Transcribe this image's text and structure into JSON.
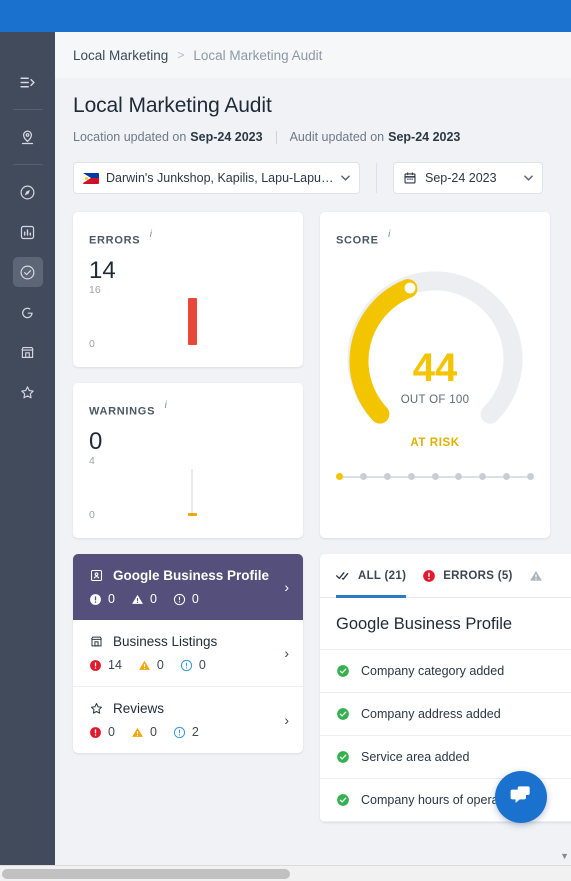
{
  "topbar": {
    "color": "#1b72ce"
  },
  "sidebar": {
    "toggle": {
      "icon": "collapse-menu-icon"
    },
    "items": [
      {
        "icon": "location-pin-icon",
        "name": "locations",
        "active": false
      },
      {
        "icon": "compass-icon",
        "name": "discovery",
        "active": false
      },
      {
        "icon": "bar-chart-icon",
        "name": "reports",
        "active": false
      },
      {
        "icon": "check-circle-icon",
        "name": "audit",
        "active": true
      },
      {
        "icon": "g-circle-icon",
        "name": "google",
        "active": false
      },
      {
        "icon": "store-icon",
        "name": "listings",
        "active": false
      },
      {
        "icon": "star-icon",
        "name": "reviews",
        "active": false
      }
    ]
  },
  "breadcrumb": {
    "parent": "Local Marketing",
    "separator": ">",
    "current": "Local Marketing Audit"
  },
  "header": {
    "title": "Local Marketing Audit",
    "location_updated_label": "Location updated on",
    "location_updated_value": "Sep-24 2023",
    "audit_updated_label": "Audit updated on",
    "audit_updated_value": "Sep-24 2023"
  },
  "filters": {
    "location": {
      "value": "Darwin's Junkshop, Kapilis, Lapu-Lapu,...",
      "flag": "philippines-flag-icon",
      "caret": "⌄"
    },
    "date": {
      "value": "Sep-24 2023",
      "icon": "calendar-icon",
      "caret": "⌄"
    }
  },
  "cards": {
    "errors": {
      "label": "ERRORS",
      "value": "14",
      "axis_max": "16",
      "axis_min": "0",
      "color": "#e8483a",
      "info": "i"
    },
    "warnings": {
      "label": "WARNINGS",
      "value": "0",
      "axis_max": "4",
      "axis_min": "0",
      "color": "#f2a50c",
      "info": "i"
    },
    "score": {
      "label": "SCORE",
      "value": "44",
      "out_of": "OUT OF 100",
      "status": "AT RISK",
      "info": "i",
      "accent": "#f2c500",
      "track": "#eceef2",
      "dots_total": 9,
      "dots_active_index": 0
    }
  },
  "profile_list": [
    {
      "name": "Google Business Profile",
      "icon": "profile-card-icon",
      "selected": true,
      "errors": "0",
      "warnings": "0",
      "notices": "0",
      "chevron": "›"
    },
    {
      "name": "Business Listings",
      "icon": "store-icon",
      "selected": false,
      "errors": "14",
      "warnings": "0",
      "notices": "0",
      "chevron": "›"
    },
    {
      "name": "Reviews",
      "icon": "star-icon",
      "selected": false,
      "errors": "0",
      "warnings": "0",
      "notices": "2",
      "chevron": "›"
    }
  ],
  "detail": {
    "tabs": [
      {
        "label": "ALL (21)",
        "icon": "double-check-icon",
        "active": true
      },
      {
        "label": "ERRORS (5)",
        "icon": "error-circle-icon",
        "active": false
      },
      {
        "label": "",
        "icon": "warning-triangle-icon",
        "active": false
      }
    ],
    "title": "Google Business Profile",
    "items": [
      {
        "status": "pass",
        "text": "Company category added"
      },
      {
        "status": "pass",
        "text": "Company address added"
      },
      {
        "status": "pass",
        "text": "Service area added"
      },
      {
        "status": "pass",
        "text": "Company hours of operation ad"
      }
    ]
  },
  "chat": {
    "icon": "chat-bubble-icon",
    "color": "#1b72ce"
  },
  "colors": {
    "error": "#e8483a",
    "warning": "#f2a50c",
    "notice": "#3a9ad9",
    "pass": "#34b14f",
    "accent_blue": "#1b72ce",
    "purple": "#54507b"
  }
}
